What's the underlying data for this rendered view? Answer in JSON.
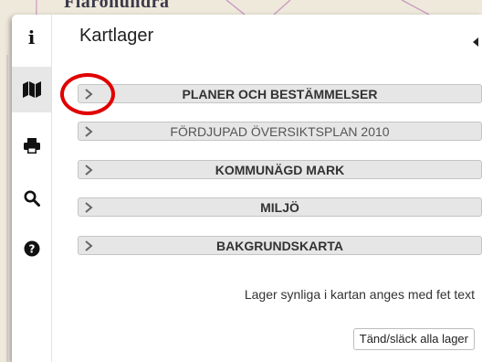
{
  "map": {
    "place_label": "Flarðhundra"
  },
  "sidebar": {
    "icons": [
      {
        "name": "info-icon",
        "glyph": "i"
      },
      {
        "name": "map-icon"
      },
      {
        "name": "print-icon"
      },
      {
        "name": "search-icon"
      },
      {
        "name": "help-icon"
      }
    ]
  },
  "panel": {
    "title": "Kartlager",
    "layers": [
      {
        "label": "PLANER OCH BESTÄMMELSER",
        "bold": true
      },
      {
        "label": "FÖRDJUPAD ÖVERSIKTSPLAN 2010",
        "bold": false
      },
      {
        "label": "KOMMUNÄGD MARK",
        "bold": true
      },
      {
        "label": "MILJÖ",
        "bold": true
      },
      {
        "label": "BAKGRUNDSKARTA",
        "bold": true
      }
    ],
    "hint": "Lager synliga i kartan anges med fet text",
    "toggle_all_label": "Tänd/släck alla lager"
  },
  "colors": {
    "annotation": "#e00000",
    "active_tab": "#e7e7e7"
  }
}
